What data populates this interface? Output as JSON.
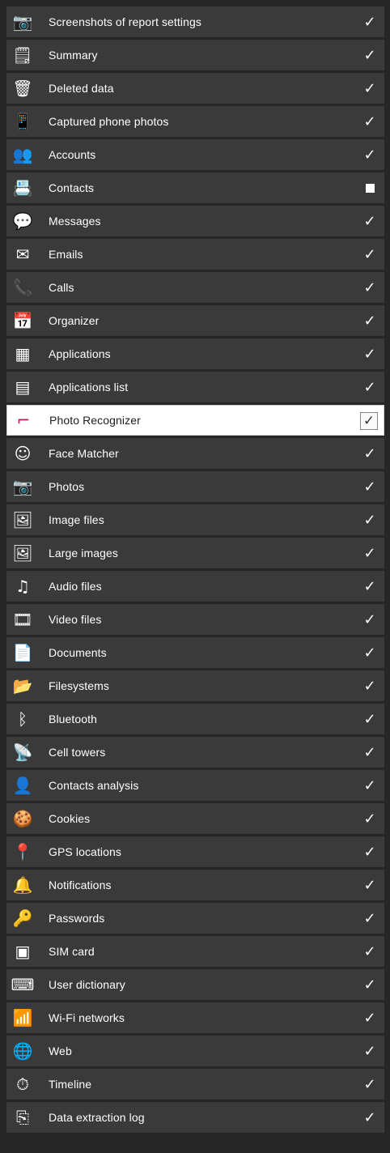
{
  "rows": [
    {
      "label": "Screenshots of report settings",
      "icon": "camera-icon",
      "glyph": "📷",
      "checked": true
    },
    {
      "label": "Summary",
      "icon": "summary-document-icon",
      "glyph": "🗒",
      "checked": true
    },
    {
      "label": "Deleted data",
      "icon": "deleted-data-icon",
      "glyph": "🗑",
      "checked": true
    },
    {
      "label": "Captured phone photos",
      "icon": "phone-capture-icon",
      "glyph": "📱",
      "checked": true
    },
    {
      "label": "Accounts",
      "icon": "accounts-icon",
      "glyph": "👥",
      "checked": true
    },
    {
      "label": "Contacts",
      "icon": "contacts-icon",
      "glyph": "📇",
      "checked": false
    },
    {
      "label": "Messages",
      "icon": "messages-icon",
      "glyph": "💬",
      "checked": true
    },
    {
      "label": "Emails",
      "icon": "email-icon",
      "glyph": "✉",
      "checked": true
    },
    {
      "label": "Calls",
      "icon": "calls-icon",
      "glyph": "📞",
      "checked": true
    },
    {
      "label": "Organizer",
      "icon": "organizer-icon",
      "glyph": "📅",
      "checked": true
    },
    {
      "label": "Applications",
      "icon": "applications-grid-icon",
      "glyph": "▦",
      "checked": true
    },
    {
      "label": "Applications list",
      "icon": "applications-list-icon",
      "glyph": "▤",
      "checked": true
    },
    {
      "label": "Photo Recognizer",
      "icon": "photo-recognizer-gun-icon",
      "glyph": "⌐",
      "checked": true,
      "selected": true
    },
    {
      "label": "Face Matcher",
      "icon": "face-matcher-icon",
      "glyph": "☺",
      "checked": true
    },
    {
      "label": "Photos",
      "icon": "photos-camera-icon",
      "glyph": "📷",
      "checked": true
    },
    {
      "label": "Image files",
      "icon": "image-files-icon",
      "glyph": "🖼",
      "checked": true
    },
    {
      "label": "Large images",
      "icon": "large-images-icon",
      "glyph": "🖼",
      "checked": true
    },
    {
      "label": "Audio files",
      "icon": "music-note-icon",
      "glyph": "♫",
      "checked": true
    },
    {
      "label": "Video files",
      "icon": "film-icon",
      "glyph": "🎞",
      "checked": true
    },
    {
      "label": "Documents",
      "icon": "documents-icon",
      "glyph": "📄",
      "checked": true
    },
    {
      "label": "Filesystems",
      "icon": "folder-icon",
      "glyph": "📂",
      "checked": true
    },
    {
      "label": "Bluetooth",
      "icon": "bluetooth-icon",
      "glyph": "ᛒ",
      "checked": true
    },
    {
      "label": "Cell towers",
      "icon": "cell-tower-icon",
      "glyph": "📡",
      "checked": true
    },
    {
      "label": "Contacts analysis",
      "icon": "contacts-analysis-icon",
      "glyph": "👤",
      "checked": true
    },
    {
      "label": "Cookies",
      "icon": "cookie-icon",
      "glyph": "🍪",
      "checked": true
    },
    {
      "label": "GPS locations",
      "icon": "location-pin-icon",
      "glyph": "📍",
      "checked": true
    },
    {
      "label": "Notifications",
      "icon": "bell-icon",
      "glyph": "🔔",
      "checked": true
    },
    {
      "label": "Passwords",
      "icon": "key-icon",
      "glyph": "🔑",
      "checked": true
    },
    {
      "label": "SIM card",
      "icon": "sim-card-icon",
      "glyph": "▣",
      "checked": true
    },
    {
      "label": "User dictionary",
      "icon": "keyboard-icon",
      "glyph": "⌨",
      "checked": true
    },
    {
      "label": "Wi-Fi networks",
      "icon": "wifi-icon",
      "glyph": "📶",
      "checked": true
    },
    {
      "label": "Web",
      "icon": "globe-icon",
      "glyph": "🌐",
      "checked": true
    },
    {
      "label": "Timeline",
      "icon": "timeline-clock-icon",
      "glyph": "⏱",
      "checked": true
    },
    {
      "label": "Data extraction log",
      "icon": "extraction-log-icon",
      "glyph": "⎘",
      "checked": true
    }
  ],
  "check_glyph": "✓",
  "colors": {
    "background": "#262626",
    "row": "#3a3a3a",
    "selected_row": "#ffffff",
    "accent": "#c2185b"
  }
}
